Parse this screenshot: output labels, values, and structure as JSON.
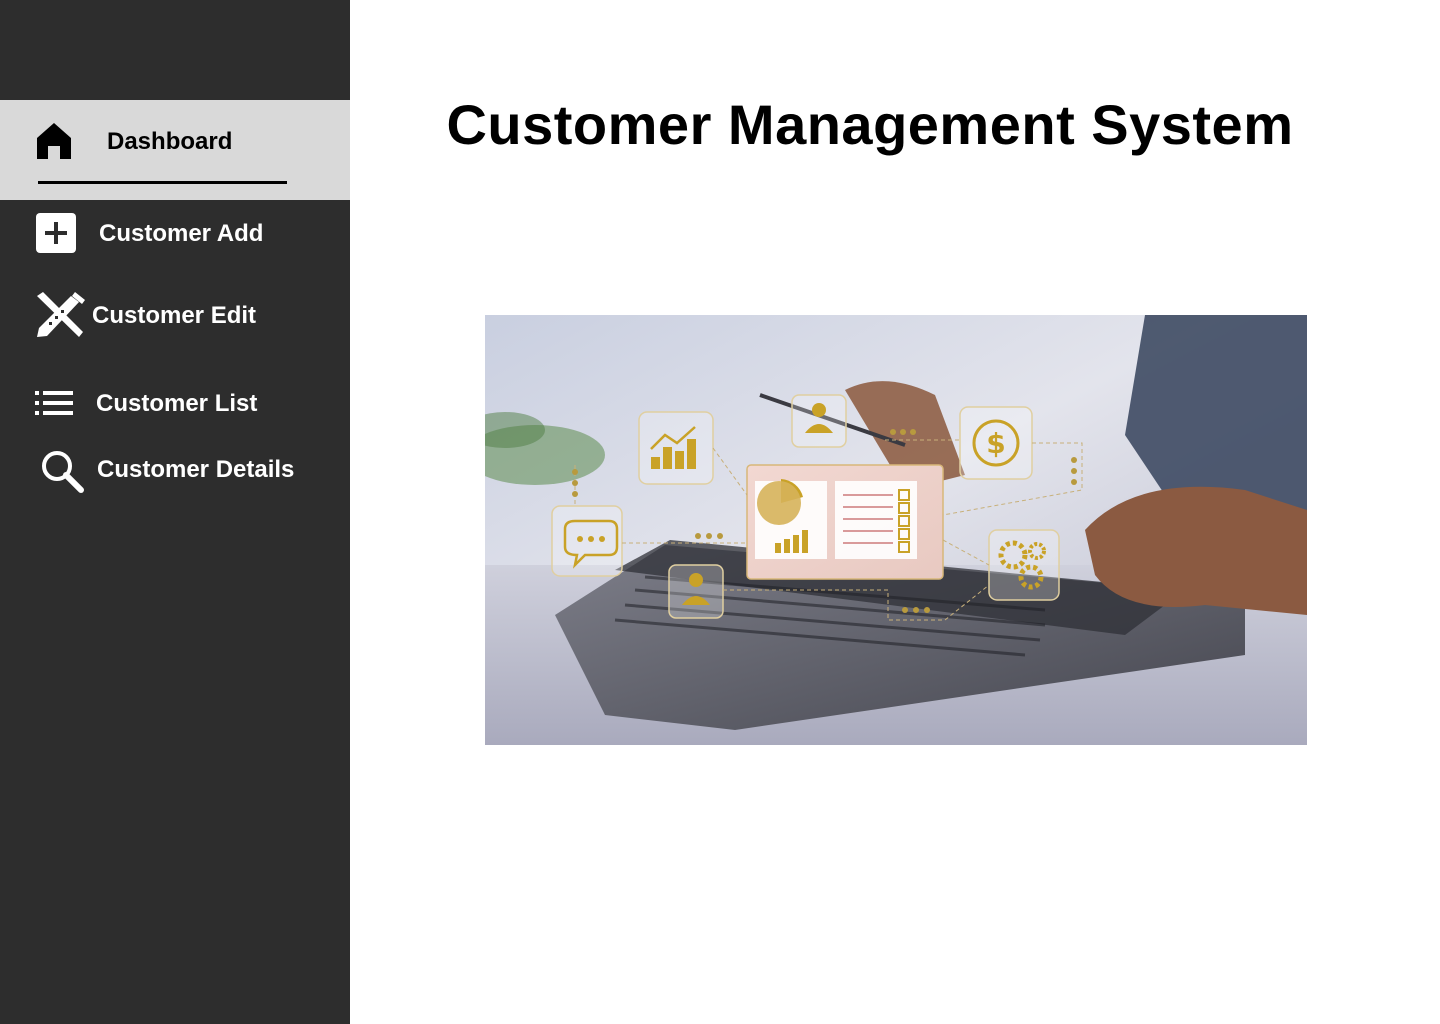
{
  "sidebar": {
    "items": [
      {
        "label": "Dashboard",
        "icon": "home-icon",
        "active": true
      },
      {
        "label": "Customer Add",
        "icon": "plus-square-icon",
        "active": false
      },
      {
        "label": "Customer Edit",
        "icon": "pencil-ruler-icon",
        "active": false
      },
      {
        "label": "Customer List",
        "icon": "list-icon",
        "active": false
      },
      {
        "label": "Customer Details",
        "icon": "search-icon",
        "active": false
      }
    ]
  },
  "main": {
    "title": "Customer Management System",
    "hero_image": "laptop-crm-illustration"
  },
  "colors": {
    "sidebar_bg": "#2d2d2d",
    "active_item_bg": "#d9d9d9",
    "accent_gold": "#c9a227"
  }
}
